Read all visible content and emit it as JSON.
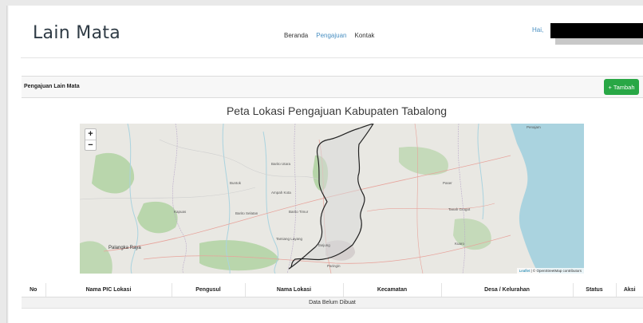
{
  "navbar": {
    "brand": "Lain Mata",
    "links": [
      {
        "label": "Beranda",
        "active": false
      },
      {
        "label": "Pengajuan",
        "active": true
      },
      {
        "label": "Kontak",
        "active": false
      }
    ],
    "greeting": "Hai,"
  },
  "card": {
    "title": "Pengajuan Lain Mata",
    "add_button": {
      "icon": "plus-icon",
      "label": "Tambah"
    }
  },
  "map": {
    "title": "Peta Lokasi Pengajuan Kabupaten Tabalong",
    "zoom_in": "+",
    "zoom_out": "−",
    "attribution_leaflet": "Leaflet",
    "attribution_rest": "| © OpenStreetMap contributors",
    "labels": {
      "palangka_raya": "Palangka Raya",
      "tanjung": "Tanjung",
      "buntok": "Buntok",
      "ampah_kota": "Ampah Kota",
      "tamiang_layang": "Tamiang Layang",
      "paringin": "Paringin",
      "tanah_grogot": "Tanah Grogot",
      "kuaro": "Kuaro",
      "paser": "Paser",
      "kapuas": "Kapuas",
      "barito_selatan": "Barito Selatan",
      "barito_timur": "Barito Timur",
      "barito_utara": "Barito Utara",
      "penajam": "Penajam"
    },
    "colors": {
      "land": "#e9e8e3",
      "sea": "#aad3df",
      "forest": "#add19e",
      "boundary": "#222222",
      "region_fill": "#d9d9d9"
    }
  },
  "table": {
    "columns": [
      "No",
      "Nama PIC Lokasi",
      "Pengusul",
      "Nama Lokasi",
      "Kecamatan",
      "Desa / Kelurahan",
      "Status",
      "Aksi"
    ],
    "empty_message": "Data Belum Dibuat"
  }
}
